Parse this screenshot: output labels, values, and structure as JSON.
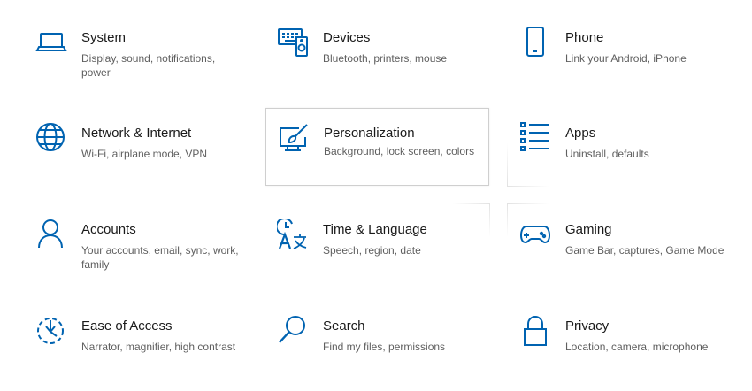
{
  "accent": "#0063b1",
  "tiles": [
    {
      "id": "system",
      "icon": "laptop-icon",
      "title": "System",
      "desc": "Display, sound, notifications, power"
    },
    {
      "id": "devices",
      "icon": "devices-icon",
      "title": "Devices",
      "desc": "Bluetooth, printers, mouse"
    },
    {
      "id": "phone",
      "icon": "phone-icon",
      "title": "Phone",
      "desc": "Link your Android, iPhone"
    },
    {
      "id": "network",
      "icon": "globe-icon",
      "title": "Network & Internet",
      "desc": "Wi-Fi, airplane mode, VPN"
    },
    {
      "id": "personalization",
      "icon": "paintbrush-icon",
      "title": "Personalization",
      "desc": "Background, lock screen, colors"
    },
    {
      "id": "apps",
      "icon": "apps-list-icon",
      "title": "Apps",
      "desc": "Uninstall, defaults"
    },
    {
      "id": "accounts",
      "icon": "person-icon",
      "title": "Accounts",
      "desc": "Your accounts, email, sync, work, family"
    },
    {
      "id": "time-language",
      "icon": "time-language-icon",
      "title": "Time & Language",
      "desc": "Speech, region, date"
    },
    {
      "id": "gaming",
      "icon": "gamepad-icon",
      "title": "Gaming",
      "desc": "Game Bar, captures, Game Mode"
    },
    {
      "id": "ease-of-access",
      "icon": "ease-of-access-icon",
      "title": "Ease of Access",
      "desc": "Narrator, magnifier, high contrast"
    },
    {
      "id": "search",
      "icon": "search-icon",
      "title": "Search",
      "desc": "Find my files, permissions"
    },
    {
      "id": "privacy",
      "icon": "lock-icon",
      "title": "Privacy",
      "desc": "Location, camera, microphone"
    }
  ]
}
